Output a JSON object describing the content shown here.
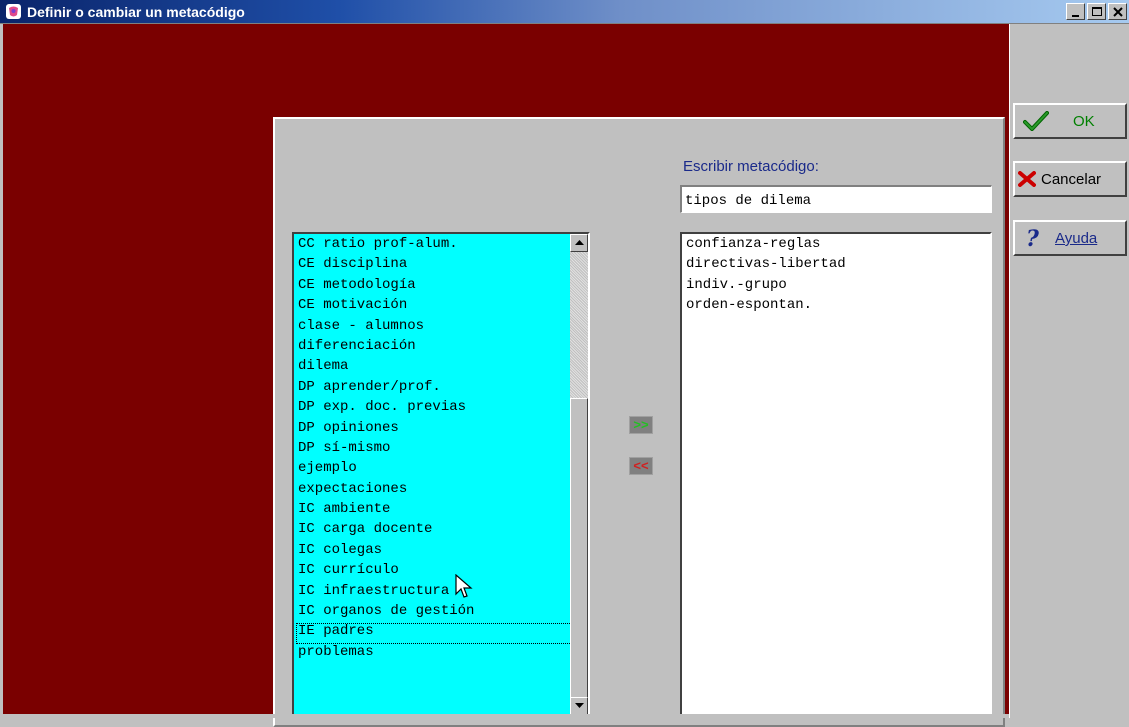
{
  "window": {
    "title": "Definir o cambiar un metacódigo"
  },
  "form": {
    "meta_label": "Escribir metacódigo:",
    "meta_value": "tipos de dilema"
  },
  "left_list": {
    "items": [
      "CC ratio prof-alum.",
      "CE disciplina",
      "CE metodología",
      "CE motivación",
      "clase - alumnos",
      "diferenciación",
      "dilema",
      "DP aprender/prof.",
      "DP exp. doc. previas",
      "DP opiniones",
      "DP sí-mismo",
      "ejemplo",
      "expectaciones",
      "IC ambiente",
      "IC carga docente",
      "IC colegas",
      "IC currículo",
      "IC infraestructura",
      "IC organos de gestión",
      "IE padres",
      "problemas"
    ],
    "focused_item": "IE padres"
  },
  "right_list": {
    "items": [
      "confianza-reglas",
      "directivas-libertad",
      "indiv.-grupo",
      "orden-espontan."
    ]
  },
  "move_buttons": {
    "add_label": ">>",
    "remove_label": "<<"
  },
  "side_buttons": {
    "ok_label": "OK",
    "cancel_label": "Cancelar",
    "help_label": "Ayuda"
  },
  "icons": {
    "app": "app-icon",
    "ok": "checkmark-icon",
    "cancel": "x-icon",
    "help": "question-icon"
  },
  "colors": {
    "background": "#7a0000",
    "left_list_bg": "#00ffff",
    "ok_text": "#008000",
    "cancel_icon": "#cc0000",
    "help_icon": "#1a2a8a"
  }
}
